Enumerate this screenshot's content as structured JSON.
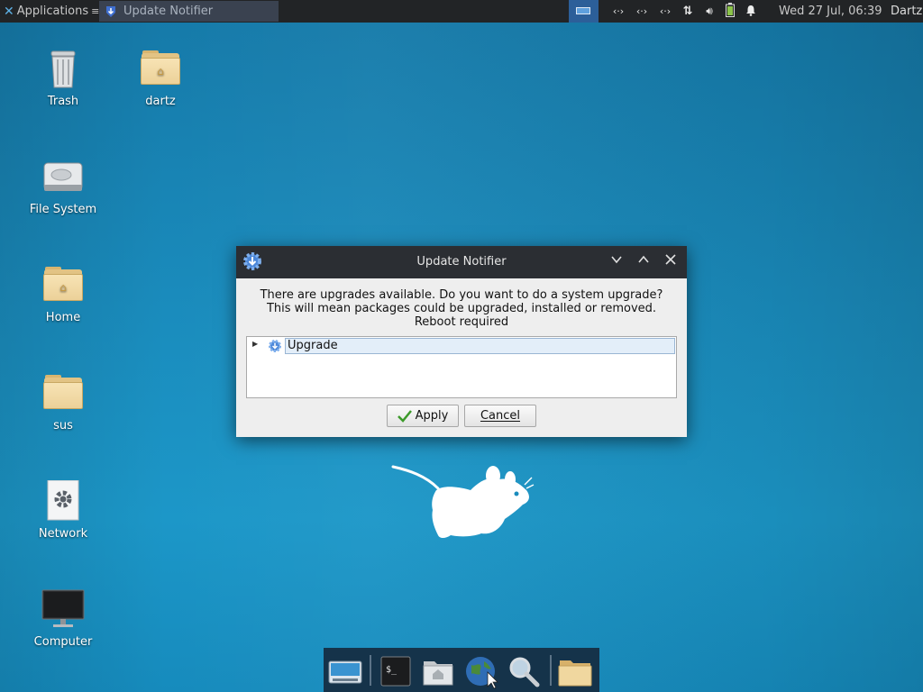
{
  "top_panel": {
    "applications_label": "Applications",
    "task_label": "Update Notifier",
    "tray": {
      "icons": [
        "network-icon",
        "network-icon",
        "network-icon",
        "transfer-icon",
        "volume-icon",
        "battery-icon",
        "notification-bell-icon"
      ]
    },
    "clock": "Wed 27 Jul, 06:39",
    "user": "Dartz"
  },
  "desktop": {
    "icons": [
      {
        "name": "trash",
        "label": "Trash"
      },
      {
        "name": "dartz",
        "label": "dartz"
      },
      {
        "name": "file-system",
        "label": "File System"
      },
      {
        "name": "home",
        "label": "Home"
      },
      {
        "name": "sus",
        "label": "sus"
      },
      {
        "name": "network",
        "label": "Network"
      },
      {
        "name": "computer",
        "label": "Computer"
      }
    ]
  },
  "dialog": {
    "title": "Update Notifier",
    "message_line1": "There are upgrades available. Do you want to do a system upgrade?",
    "message_line2": "This will mean packages could be upgraded, installed or removed.",
    "message_line3": "Reboot required",
    "tree_item": "Upgrade",
    "apply_label": "Apply",
    "cancel_label": "Cancel",
    "colors": {
      "titlebar": "#2b2e33",
      "selection": "#e3eef9"
    }
  },
  "dock": {
    "items": [
      "show-desktop-icon",
      "terminal-icon",
      "home-folder-icon",
      "web-browser-icon",
      "search-icon",
      "file-manager-icon"
    ]
  },
  "colors": {
    "desktop": "#1a8cbd",
    "panel": "#222426",
    "workspace": "#2c5f99"
  }
}
